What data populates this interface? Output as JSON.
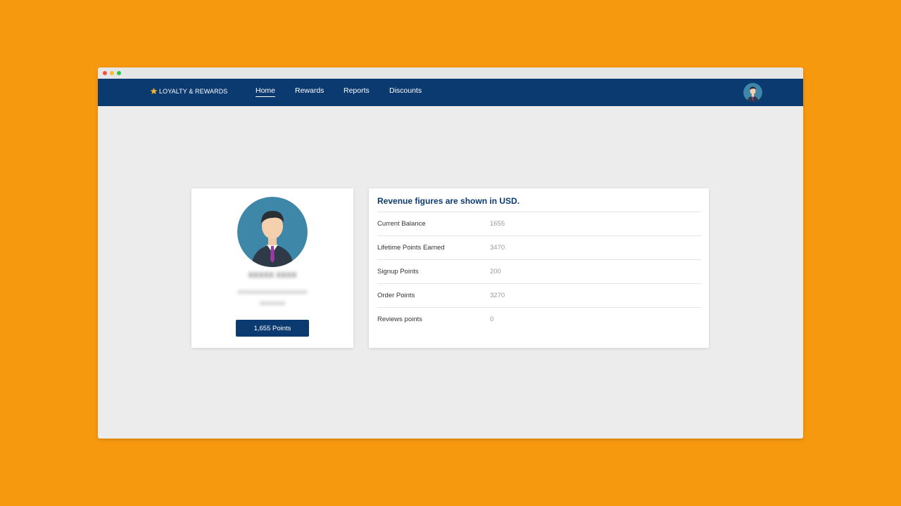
{
  "window": {
    "controls": [
      "close",
      "minimize",
      "maximize"
    ]
  },
  "navbar": {
    "brand_icon": "star-icon",
    "brand": "LOYALTY & REWARDS",
    "links": [
      {
        "label": "Home",
        "active": true
      },
      {
        "label": "Rewards",
        "active": false
      },
      {
        "label": "Reports",
        "active": false
      },
      {
        "label": "Discounts",
        "active": false
      }
    ],
    "avatar_icon": "user-avatar-icon"
  },
  "profile": {
    "avatar_icon": "user-avatar-icon",
    "name": "XXXXX XXXX",
    "email": "xxxxxxxxxxxxxxxxxxxxxx",
    "extra": "xxxxxxxx",
    "points_button": "1,655 Points"
  },
  "stats": {
    "title": "Revenue figures are shown in USD.",
    "rows": [
      {
        "label": "Current Balance",
        "value": "1655"
      },
      {
        "label": "Lifetime Points Earned",
        "value": "3470"
      },
      {
        "label": "Signup Points",
        "value": "200"
      },
      {
        "label": "Order Points",
        "value": "3270"
      },
      {
        "label": "Reviews points",
        "value": "0"
      }
    ]
  },
  "colors": {
    "background": "#f7990f",
    "navbar": "#0b3a70",
    "accent_star": "#f5b52a",
    "window": "#ececec"
  }
}
